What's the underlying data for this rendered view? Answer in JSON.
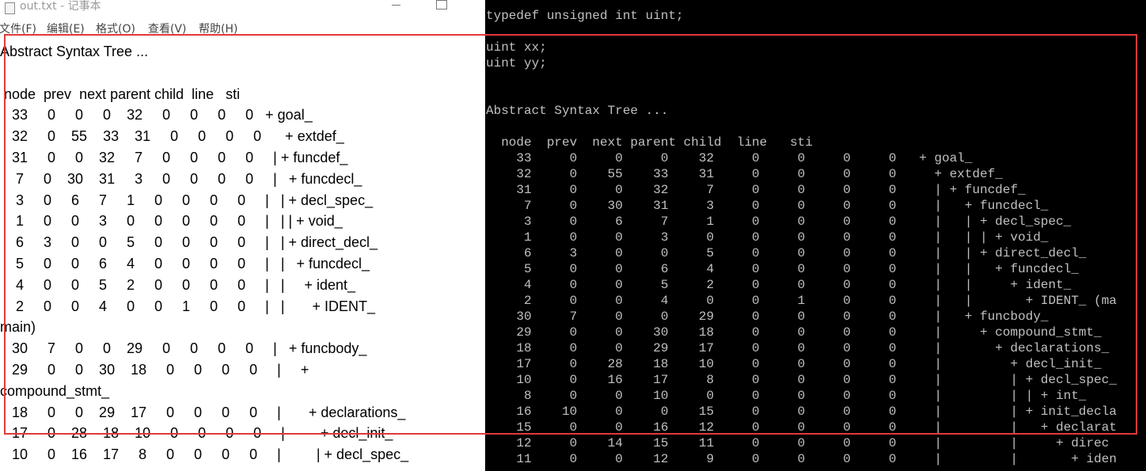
{
  "notepad": {
    "title": "out.txt - 记事本",
    "menu": [
      "文件(F)",
      "编辑(E)",
      "格式(O)",
      "查看(V)",
      "帮助(H)"
    ],
    "lines": [
      "Abstract Syntax Tree ...",
      "",
      " node  prev  next parent child  line   sti",
      "   33     0     0     0    32     0     0     0     0   + goal_",
      "   32     0    55    33    31     0     0     0     0      + extdef_",
      "   31     0     0    32     7     0     0     0     0     | + funcdef_",
      "    7     0    30    31     3     0     0     0     0     |   + funcdecl_",
      "    3     0     6     7     1     0     0     0     0     |   | + decl_spec_",
      "    1     0     0     3     0     0     0     0     0     |   | | + void_",
      "    6     3     0     0     5     0     0     0     0     |   | + direct_decl_",
      "    5     0     0     6     4     0     0     0     0     |   |   + funcdecl_",
      "    4     0     0     5     2     0     0     0     0     |   |     + ident_",
      "    2     0     0     4     0     0     1     0     0     |   |       + IDENT_",
      "main)",
      "   30     7     0     0    29     0     0     0     0     |   + funcbody_",
      "   29     0     0    30    18     0     0     0     0     |     +",
      "compound_stmt_",
      "   18     0     0    29    17     0     0     0     0     |       + declarations_",
      "   17     0    28    18    10     0     0     0     0     |         + decl_init_",
      "   10     0    16    17     8     0     0     0     0     |         | + decl_spec_"
    ]
  },
  "console": {
    "lines": [
      "typedef unsigned int uint;",
      "",
      "uint xx;",
      "uint yy;",
      "",
      "",
      "Abstract Syntax Tree ...",
      "",
      "  node  prev  next parent child  line   sti",
      "    33     0     0     0    32     0     0     0     0   + goal_",
      "    32     0    55    33    31     0     0     0     0     + extdef_",
      "    31     0     0    32     7     0     0     0     0     | + funcdef_",
      "     7     0    30    31     3     0     0     0     0     |   + funcdecl_",
      "     3     0     6     7     1     0     0     0     0     |   | + decl_spec_",
      "     1     0     0     3     0     0     0     0     0     |   | | + void_",
      "     6     3     0     0     5     0     0     0     0     |   | + direct_decl_",
      "     5     0     0     6     4     0     0     0     0     |   |   + funcdecl_",
      "     4     0     0     5     2     0     0     0     0     |   |     + ident_",
      "     2     0     0     4     0     0     1     0     0     |   |       + IDENT_ (ma",
      "    30     7     0     0    29     0     0     0     0     |   + funcbody_",
      "    29     0     0    30    18     0     0     0     0     |     + compound_stmt_",
      "    18     0     0    29    17     0     0     0     0     |       + declarations_",
      "    17     0    28    18    10     0     0     0     0     |         + decl_init_",
      "    10     0    16    17     8     0     0     0     0     |         | + decl_spec_",
      "     8     0     0    10     0     0     0     0     0     |         | | + int_",
      "    16    10     0     0    15     0     0     0     0     |         | + init_decla",
      "    15     0     0    16    12     0     0     0     0     |         |   + declarat",
      "    12     0    14    15    11     0     0     0     0     |         |     + direc",
      "    11     0     0    12     9     0     0     0     0     |         |       + iden"
    ]
  },
  "annotation": {
    "color": "#e03a3a"
  }
}
